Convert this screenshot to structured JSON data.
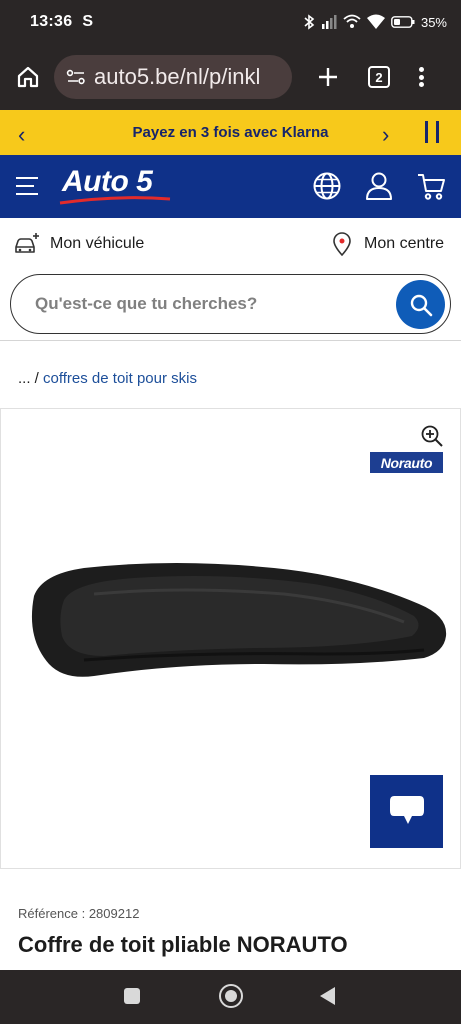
{
  "status_bar": {
    "time": "13:36",
    "carrier_glyph": "S",
    "battery": "35%",
    "icons": [
      "bluetooth-icon",
      "signal-icon",
      "wifi-calling-icon",
      "wifi-icon",
      "battery-icon"
    ]
  },
  "browser": {
    "url": "auto5.be/nl/p/inkl",
    "tab_count": "2"
  },
  "promo": {
    "text": "Payez en 3 fois avec Klarna",
    "prev_glyph": "‹",
    "next_glyph": "›"
  },
  "header": {
    "logo_text": "Auto 5",
    "icons": [
      "language-globe-icon",
      "account-icon",
      "cart-icon"
    ],
    "colors": {
      "header_bg": "#0f3189",
      "promo_bg": "#f7c91b"
    }
  },
  "util": {
    "vehicle_label": "Mon véhicule",
    "centre_label": "Mon centre"
  },
  "search": {
    "placeholder": "Qu'est-ce que tu cherches?"
  },
  "breadcrumb": {
    "ellipsis": "... /",
    "current": "coffres de toit pour skis"
  },
  "product": {
    "brand_badge": "Norauto",
    "reference": "Référence : 2809212",
    "title": "Coffre de toit pliable NORAUTO"
  }
}
